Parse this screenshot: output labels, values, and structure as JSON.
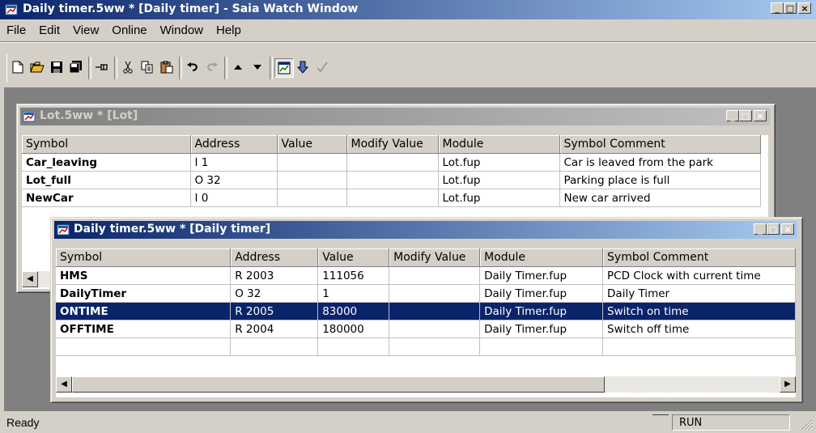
{
  "app": {
    "title": "Daily timer.5ww * [Daily timer] - Saia Watch Window",
    "min_btn": "_",
    "max_btn": "□",
    "close_btn": "×"
  },
  "menu": [
    "File",
    "Edit",
    "View",
    "Online",
    "Window",
    "Help"
  ],
  "toolbar": {
    "icons": [
      "new-file-icon",
      "open-folder-icon",
      "save-icon",
      "save-all-icon",
      "pin-icon",
      "cut-icon",
      "copy-icon",
      "paste-icon",
      "undo-icon",
      "redo-icon",
      "move-up-icon",
      "move-down-icon",
      "watch-window-icon",
      "download-icon",
      "check-icon"
    ]
  },
  "columns": [
    "Symbol",
    "Address",
    "Value",
    "Modify Value",
    "Module",
    "Symbol Comment"
  ],
  "lot_window": {
    "title": "Lot.5ww * [Lot]",
    "rows": [
      {
        "symbol": "Car_leaving",
        "address": "I 1",
        "value": "",
        "modify": "",
        "module": "Lot.fup",
        "comment": "Car is leaved from the park"
      },
      {
        "symbol": "Lot_full",
        "address": "O 32",
        "value": "",
        "modify": "",
        "module": "Lot.fup",
        "comment": "Parking place is full"
      },
      {
        "symbol": "NewCar",
        "address": "I 0",
        "value": "",
        "modify": "",
        "module": "Lot.fup",
        "comment": "New car arrived"
      }
    ]
  },
  "timer_window": {
    "title": "Daily timer.5ww * [Daily timer]",
    "rows": [
      {
        "symbol": "HMS",
        "address": "R 2003",
        "value": "111056",
        "modify": "",
        "module": "Daily Timer.fup",
        "comment": "PCD Clock with current time"
      },
      {
        "symbol": "DailyTimer",
        "address": "O 32",
        "value": "1",
        "modify": "",
        "module": "Daily Timer.fup",
        "comment": "Daily Timer"
      },
      {
        "symbol": "ONTIME",
        "address": "R 2005",
        "value": "83000",
        "modify": "",
        "module": "Daily Timer.fup",
        "comment": "Switch on time"
      },
      {
        "symbol": "OFFTIME",
        "address": "R 2004",
        "value": "180000",
        "modify": "",
        "module": "Daily Timer.fup",
        "comment": "Switch off time"
      }
    ],
    "selected_row": 2
  },
  "status": {
    "ready": "Ready",
    "mode": "RUN"
  },
  "colors": {
    "selection": "#0a246a",
    "titlebar_start": "#0a246a",
    "titlebar_end": "#a6caf0",
    "inactive_title_start": "#808080",
    "inactive_title_end": "#c0c0c0"
  }
}
